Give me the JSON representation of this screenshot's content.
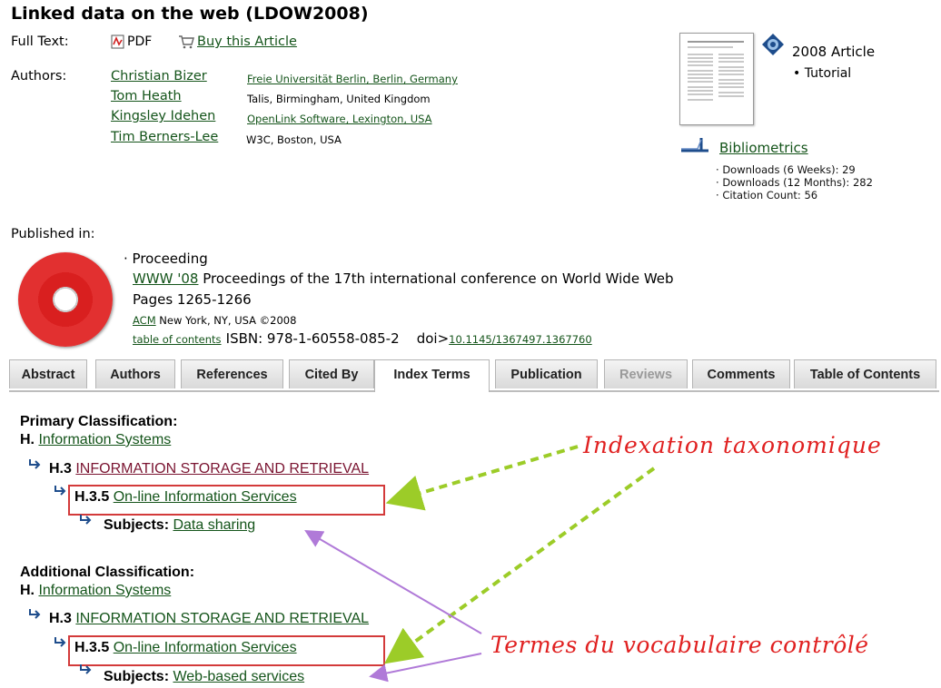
{
  "title": "Linked data on the web (LDOW2008)",
  "full_text": {
    "label": "Full Text:",
    "pdf_label": "PDF",
    "buy_label": "Buy this Article"
  },
  "authors": {
    "label": "Authors:",
    "list": [
      {
        "name": "Christian Bizer",
        "affiliation": "Freie Universität Berlin, Berlin, Germany"
      },
      {
        "name": "Tom Heath",
        "affiliation": "Talis, Birmingham, United Kingdom"
      },
      {
        "name": "Kingsley Idehen",
        "affiliation": "OpenLink Software, Lexington, USA"
      },
      {
        "name": "Tim Berners-Lee",
        "affiliation": "W3C, Boston, USA"
      }
    ]
  },
  "article": {
    "type": "2008 Article",
    "subtype": "Tutorial"
  },
  "bibliometrics": {
    "label": "Bibliometrics",
    "stats": [
      "Downloads (6 Weeks): 29",
      "Downloads (12 Months): 282",
      "Citation Count: 56"
    ]
  },
  "published": {
    "label": "Published in:",
    "kind": "· Proceeding",
    "conf_link": "WWW '08",
    "conf_rest": "Proceedings of the 17th international conference on World Wide Web",
    "pages": "Pages 1265-1266",
    "publisher_link": "ACM",
    "publisher_rest": "New York, NY, USA ©2008",
    "toc_link": "table of contents",
    "isbn": "ISBN: 978-1-60558-085-2",
    "doi_label": "doi>",
    "doi_link": "10.1145/1367497.1367760"
  },
  "tabs": [
    {
      "label": "Abstract",
      "state": "normal"
    },
    {
      "label": "Authors",
      "state": "normal"
    },
    {
      "label": "References",
      "state": "normal"
    },
    {
      "label": "Cited By",
      "state": "normal"
    },
    {
      "label": "Index Terms",
      "state": "active"
    },
    {
      "label": "Publication",
      "state": "normal"
    },
    {
      "label": "Reviews",
      "state": "disabled"
    },
    {
      "label": "Comments",
      "state": "normal"
    },
    {
      "label": "Table of Contents",
      "state": "normal"
    }
  ],
  "primary": {
    "heading": "Primary Classification:",
    "h_code": "H.",
    "h_name": "Information Systems",
    "h3_code": "H.3",
    "h3_name": "INFORMATION STORAGE AND RETRIEVAL",
    "h35_code": "H.3.5",
    "h35_name": "On-line Information Services",
    "subjects_label": "Subjects:",
    "subject": "Data sharing"
  },
  "additional": {
    "heading": "Additional Classification:",
    "h_code": "H.",
    "h_name": "Information Systems",
    "h3_code": "H.3",
    "h3_name": "INFORMATION STORAGE AND RETRIEVAL",
    "h35_code": "H.3.5",
    "h35_name": "On-line Information Services",
    "subjects_label": "Subjects:",
    "subject": "Web-based services"
  },
  "annotations": {
    "taxonomy": "Indexation taxonomique",
    "vocabulary": "Termes du vocabulaire contrôlé"
  },
  "colors": {
    "link": "#14541a",
    "visited_link": "#7a1431",
    "annotation_red": "#e02020",
    "arrow_green": "#9ccc28",
    "arrow_purple": "#b07ad8"
  }
}
